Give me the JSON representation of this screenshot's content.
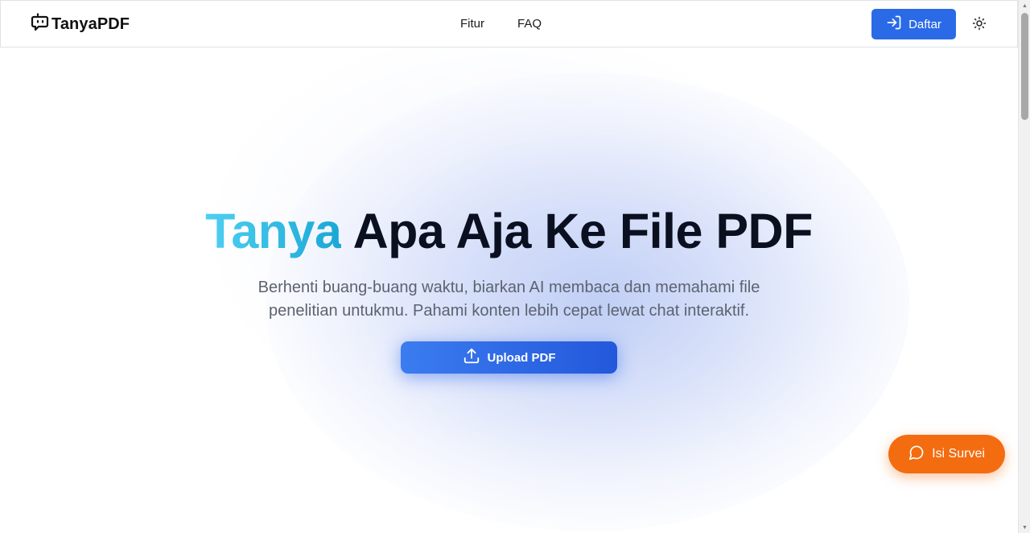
{
  "nav": {
    "brand": "TanyaPDF",
    "links": [
      "Fitur",
      "FAQ"
    ],
    "signup_label": "Daftar"
  },
  "hero": {
    "title_accent": "Tanya",
    "title_rest": "Apa Aja Ke File PDF",
    "subtitle": "Berhenti buang-buang waktu, biarkan AI membaca dan memahami file penelitian untukmu. Pahami konten lebih cepat lewat chat interaktif.",
    "upload_label": "Upload PDF"
  },
  "survey": {
    "label": "Isi Survei"
  },
  "colors": {
    "primary": "#2b6ae7",
    "accent_cyan": "#1aa7d6",
    "survey_orange": "#f36c10"
  },
  "icons": {
    "brand": "chat-bot-icon",
    "signup": "login-icon",
    "theme": "sun-icon",
    "upload": "upload-icon",
    "survey": "message-circle-icon"
  }
}
